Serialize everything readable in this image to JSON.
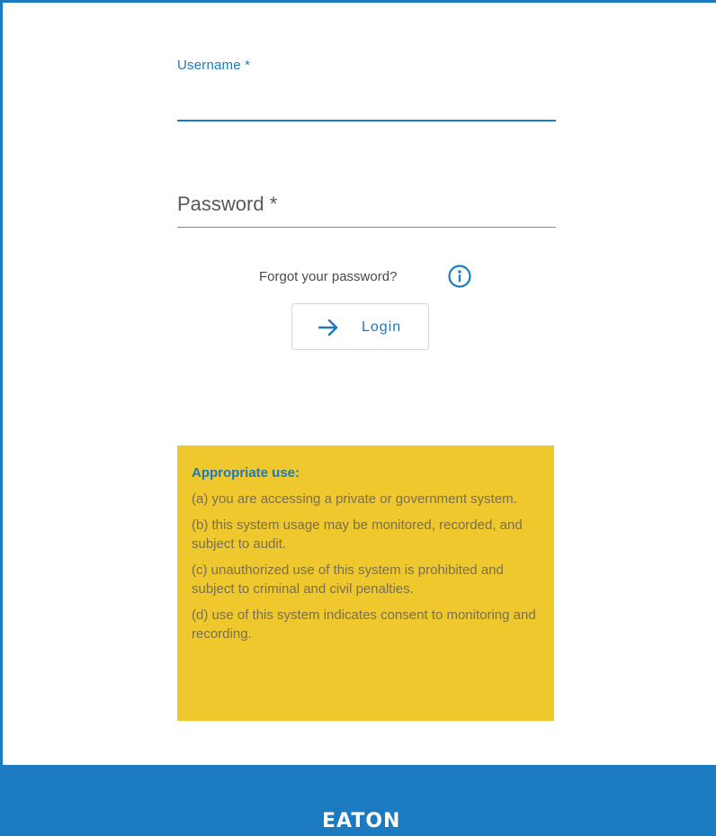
{
  "login_form": {
    "username_label": "Username *",
    "username_value": "",
    "password_label": "Password *",
    "password_value": "",
    "forgot_password": "Forgot your password?",
    "info_icon": "info-circle-icon",
    "login_label": "Login",
    "login_icon": "arrow-right-icon"
  },
  "notice": {
    "title": "Appropriate use:",
    "items": [
      "(a) you are accessing a private or government system.",
      "(b) this system usage may be monitored, recorded, and subject to audit.",
      "(c) unauthorized use of this system is prohibited and subject to criminal and civil penalties.",
      "(d) use of this system indicates consent to monitoring and recording."
    ]
  },
  "footer": {
    "logo_text": "EATON"
  },
  "colors": {
    "accent": "#1b7ac0",
    "notice_background": "#efc82e",
    "notice_text": "#7a6f4e"
  }
}
